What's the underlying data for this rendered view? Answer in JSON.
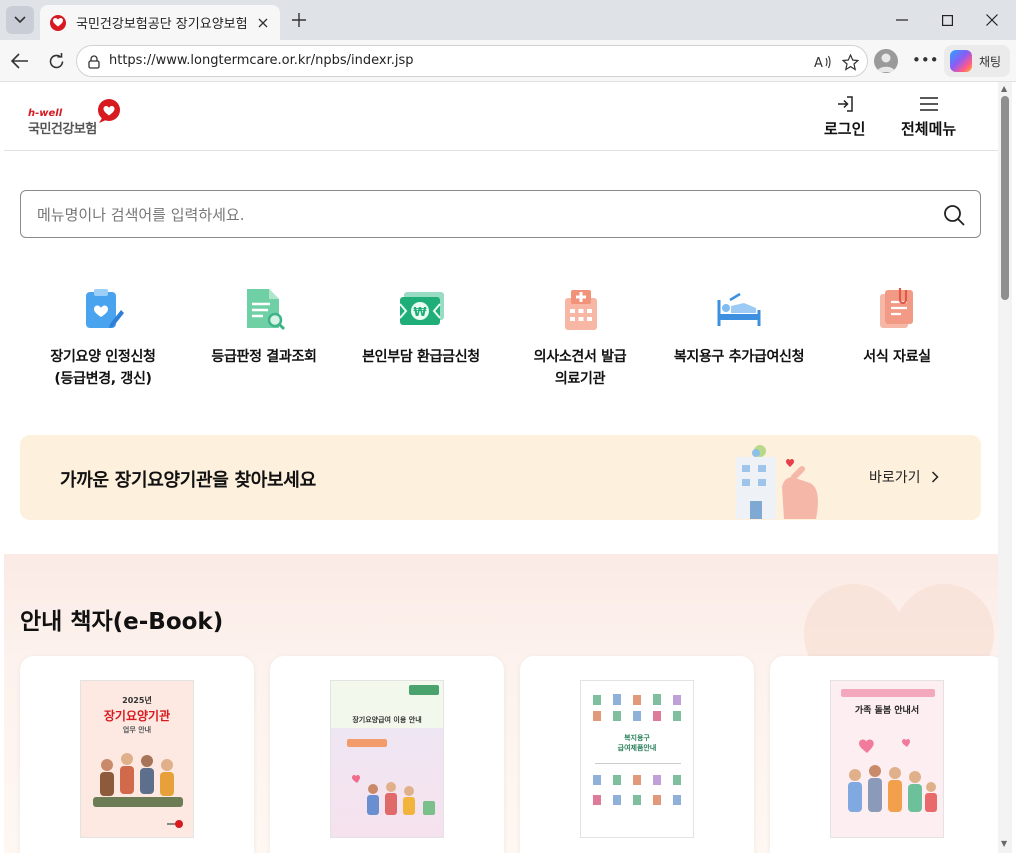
{
  "browser": {
    "tab_title": "국민건강보험공단 장기요양보험",
    "url": "https://www.longtermcare.or.kr/npbs/indexr.jsp",
    "copilot_label": "채팅"
  },
  "header": {
    "logo_sub": "h-well",
    "logo_name": "국민건강보험",
    "login_label": "로그인",
    "menu_label": "전체메뉴"
  },
  "search": {
    "placeholder": "메뉴명이나 검색어를 입력하세요."
  },
  "quick_menu": [
    {
      "line1": "장기요양 인정신청",
      "line2": "(등급변경, 갱신)",
      "icon": "clipboard-heart-icon"
    },
    {
      "line1": "등급판정 결과조회",
      "line2": "",
      "icon": "document-search-icon"
    },
    {
      "line1": "본인부담 환급금신청",
      "line2": "",
      "icon": "won-bill-icon"
    },
    {
      "line1": "의사소견서 발급",
      "line2": "의료기관",
      "icon": "hospital-icon"
    },
    {
      "line1": "복지용구 추가급여신청",
      "line2": "",
      "icon": "care-bed-icon"
    },
    {
      "line1": "서식 자료실",
      "line2": "",
      "icon": "form-clip-icon"
    }
  ],
  "finder": {
    "title": "가까운 장기요양기관을 찾아보세요",
    "link": "바로가기"
  },
  "ebook": {
    "section_title": "안내 책자(e-Book)",
    "books": [
      {
        "cover_year": "2025년",
        "cover_title": "장기요양기관",
        "cover_sub": "업무 안내"
      },
      {
        "cover_title": "장기요양급여 이용 안내"
      },
      {
        "cover_title": "복지용구",
        "cover_sub": "급여제품안내"
      },
      {
        "cover_title": "가족 돌봄 안내서"
      }
    ]
  },
  "colors": {
    "brand_red": "#d71920",
    "finder_bg": "#fdf0dc"
  }
}
